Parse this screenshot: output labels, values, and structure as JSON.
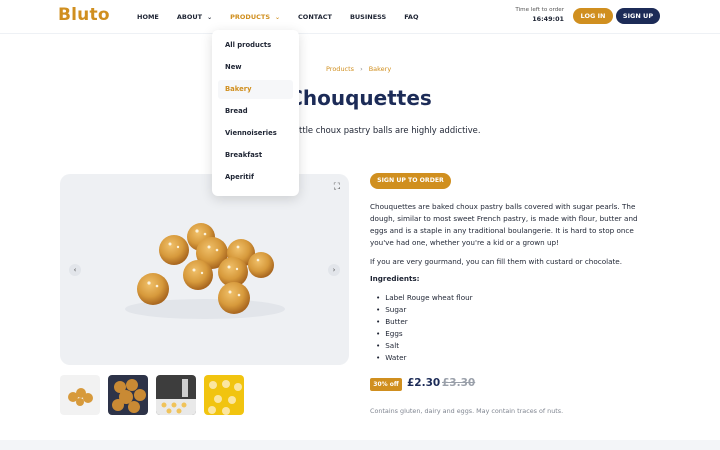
{
  "header": {
    "logo": "Bluto",
    "nav": [
      {
        "label": "HOME"
      },
      {
        "label": "ABOUT",
        "has_dropdown": true
      },
      {
        "label": "PRODUCTS",
        "has_dropdown": true,
        "active": true
      },
      {
        "label": "CONTACT"
      },
      {
        "label": "BUSINESS"
      },
      {
        "label": "FAQ"
      }
    ],
    "timer_label": "Time left to order",
    "timer_value": "16:49:01",
    "login_label": "LOG IN",
    "signup_label": "SIGN UP"
  },
  "dropdown": {
    "items": [
      "All products",
      "New",
      "Bakery",
      "Bread",
      "Viennoiseries",
      "Breakfast",
      "Aperitif"
    ],
    "active_item": "Bakery"
  },
  "breadcrumb": [
    "Products",
    "Bakery"
  ],
  "product": {
    "title": "Chouquettes",
    "subtitle": "ming! These little choux pastry balls are highly addictive.",
    "order_button": "SIGN UP TO ORDER",
    "description": "Chouquettes are baked choux pastry balls covered with sugar pearls. The dough, similar to most sweet French pastry, is made with flour, butter and eggs and is a staple in any traditional boulangerie. It is hard to stop once you've had one, whether you're a kid or a grown up!",
    "description2": "If you are very gourmand, you can fill them with custard or chocolate.",
    "ingredients_title": "Ingredients:",
    "ingredients": [
      "Label Rouge wheat flour",
      "Sugar",
      "Butter",
      "Eggs",
      "Salt",
      "Water"
    ],
    "discount": "30% off",
    "price": "£2.30",
    "old_price": "£3.30",
    "allergens": "Contains gluten, dairy and eggs. May contain traces of nuts."
  },
  "colors": {
    "accent": "#d08f1f",
    "navy": "#1c2b57"
  }
}
